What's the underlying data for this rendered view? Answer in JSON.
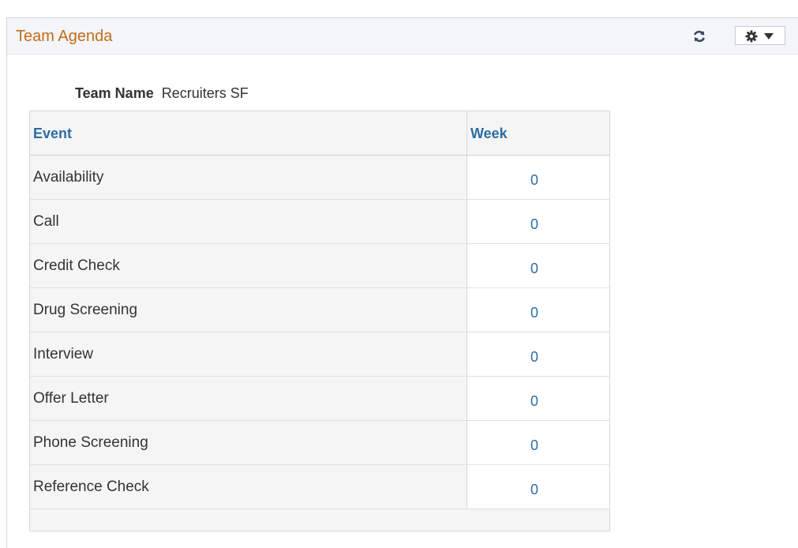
{
  "pagelet": {
    "title": "Team Agenda",
    "refresh_icon": "refresh-icon",
    "settings_icon": "gear-icon",
    "settings_dropdown_icon": "caret-down-icon"
  },
  "team": {
    "label": "Team Name",
    "value": "Recruiters SF"
  },
  "grid": {
    "columns": [
      "Event",
      "Week"
    ],
    "rows": [
      {
        "event": "Availability",
        "week": "0"
      },
      {
        "event": "Call",
        "week": "0"
      },
      {
        "event": "Credit Check",
        "week": "0"
      },
      {
        "event": "Drug Screening",
        "week": "0"
      },
      {
        "event": "Interview",
        "week": "0"
      },
      {
        "event": "Offer Letter",
        "week": "0"
      },
      {
        "event": "Phone Screening",
        "week": "0"
      },
      {
        "event": "Reference Check",
        "week": "0"
      }
    ]
  },
  "colors": {
    "title": "#c46b1c",
    "link": "#2d6ca2",
    "header_bg": "#f3f5f8"
  }
}
